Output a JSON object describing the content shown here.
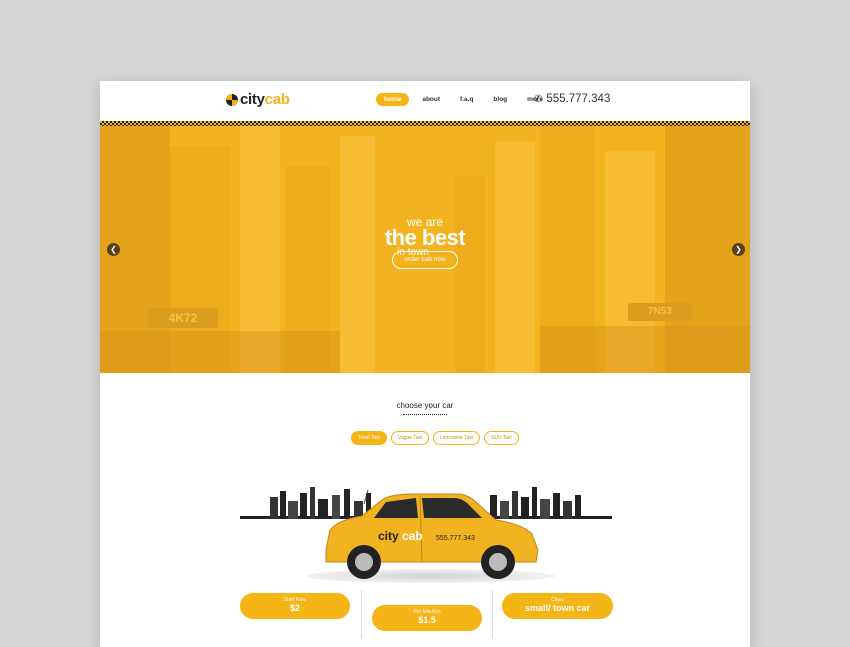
{
  "header": {
    "logo_city": "city",
    "logo_cab": "cab",
    "nav": [
      {
        "label": "home",
        "active": true
      },
      {
        "label": "about",
        "active": false
      },
      {
        "label": "f.a.q",
        "active": false
      },
      {
        "label": "blog",
        "active": false
      },
      {
        "label": "more",
        "active": false
      }
    ],
    "phone": "555.777.343",
    "phone_icon": "phone-icon"
  },
  "hero": {
    "line1": "we are",
    "line2": "the best",
    "line3": "in town",
    "button": "order cab now",
    "sign_left": "4K72",
    "sign_right": "7N53",
    "prev_icon": "chevron-left-icon",
    "next_icon": "chevron-right-icon"
  },
  "choose": {
    "title": "choose your car",
    "tabs": [
      {
        "label": "Town Taxi",
        "active": true
      },
      {
        "label": "Vague Taxi",
        "active": false
      },
      {
        "label": "Limousine Taxi",
        "active": false
      },
      {
        "label": "SUV Taxi",
        "active": false
      }
    ]
  },
  "car": {
    "brand_city": "city",
    "brand_cab": "cab",
    "phone": "555.777.343"
  },
  "prices": [
    {
      "label": "Start Rate",
      "value": "$2"
    },
    {
      "label": "Per Mile/Km",
      "value": "$1.5"
    },
    {
      "label": "Class",
      "value": "small/ town car"
    }
  ],
  "colors": {
    "accent": "#f5b517",
    "hero_bg": "#f3b31f",
    "page_bg": "#d6d6d6"
  }
}
